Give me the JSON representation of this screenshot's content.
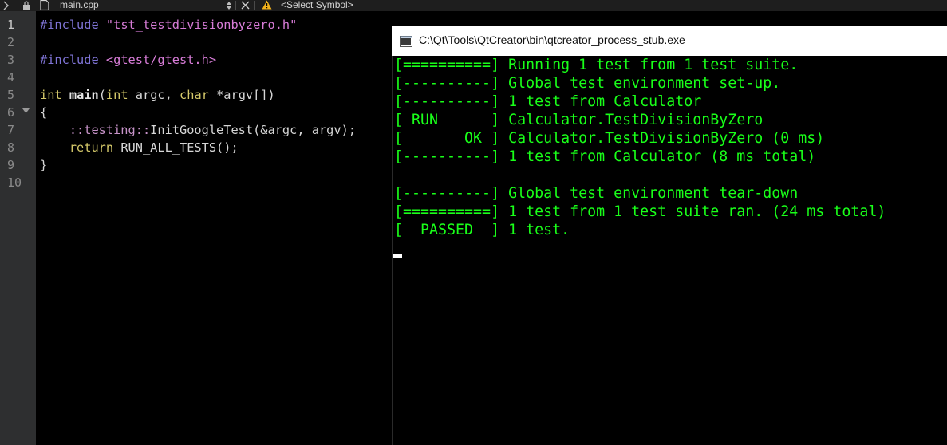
{
  "toolbar": {
    "file_name": "main.cpp",
    "symbol_placeholder": "<Select Symbol>"
  },
  "editor": {
    "line_numbers": [
      "1",
      "2",
      "3",
      "4",
      "5",
      "6",
      "7",
      "8",
      "9",
      "10"
    ],
    "lines": [
      {
        "t1": "#include",
        "t2": " ",
        "t3": "\"tst_testdivisionbyzero.h\""
      },
      {},
      {
        "t1": "#include",
        "t2": " ",
        "t3": "<gtest/gtest.h>"
      },
      {},
      {
        "t1": "int",
        "t2": " ",
        "t3": "main",
        "t4": "(",
        "t5": "int",
        "t6": " argc, ",
        "t7": "char",
        "t8": " *argv[])"
      },
      {
        "t1": "{"
      },
      {
        "t1": "    ",
        "t2": "::testing::",
        "t3": "InitGoogleTest(&argc, argv);"
      },
      {
        "t1": "    ",
        "t2": "return",
        "t3": " RUN_ALL_TESTS();"
      },
      {
        "t1": "}"
      }
    ]
  },
  "console": {
    "title": "C:\\Qt\\Tools\\QtCreator\\bin\\qtcreator_process_stub.exe",
    "lines": [
      "[==========] Running 1 test from 1 test suite.",
      "[----------] Global test environment set-up.",
      "[----------] 1 test from Calculator",
      "[ RUN      ] Calculator.TestDivisionByZero",
      "[       OK ] Calculator.TestDivisionByZero (0 ms)",
      "[----------] 1 test from Calculator (8 ms total)",
      "",
      "[----------] Global test environment tear-down",
      "[==========] 1 test from 1 test suite ran. (24 ms total)",
      "[  PASSED  ] 1 test."
    ]
  },
  "colors": {
    "console_text": "#19ff19",
    "editor_bg": "#000000",
    "gutter_bg": "#2e2f30"
  }
}
